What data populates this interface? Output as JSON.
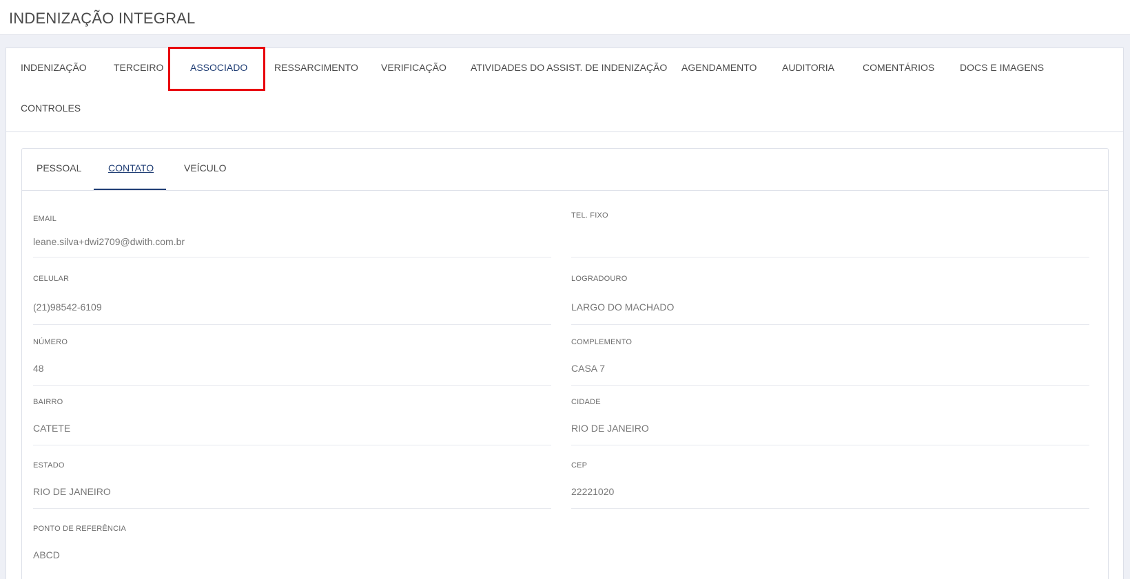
{
  "header": {
    "title": "INDENIZAÇÃO INTEGRAL"
  },
  "main_tabs": [
    {
      "label": "INDENIZAÇÃO"
    },
    {
      "label": "TERCEIRO"
    },
    {
      "label": "ASSOCIADO",
      "active": true
    },
    {
      "label": "RESSARCIMENTO"
    },
    {
      "label": "VERIFICAÇÃO"
    },
    {
      "label": "ATIVIDADES DO ASSIST. DE INDENIZAÇÃO"
    },
    {
      "label": "AGENDAMENTO"
    },
    {
      "label": "AUDITORIA"
    },
    {
      "label": "COMENTÁRIOS"
    },
    {
      "label": "DOCS E IMAGENS"
    },
    {
      "label": "CONTROLES"
    }
  ],
  "sub_tabs": [
    {
      "label": "PESSOAL"
    },
    {
      "label": "CONTATO",
      "active": true
    },
    {
      "label": "VEÍCULO"
    }
  ],
  "fields": {
    "email": {
      "label": "EMAIL",
      "value": "leane.silva+dwi2709@dwith.com.br"
    },
    "tel_fixo": {
      "label": "TEL. FIXO",
      "value": ""
    },
    "celular": {
      "label": "CELULAR",
      "value": "(21)98542-6109"
    },
    "logradouro": {
      "label": "LOGRADOURO",
      "value": "LARGO DO MACHADO"
    },
    "numero": {
      "label": "NÚMERO",
      "value": "48"
    },
    "complemento": {
      "label": "COMPLEMENTO",
      "value": "CASA 7"
    },
    "bairro": {
      "label": "BAIRRO",
      "value": "CATETE"
    },
    "cidade": {
      "label": "CIDADE",
      "value": "RIO DE JANEIRO"
    },
    "estado": {
      "label": "ESTADO",
      "value": "RIO DE JANEIRO"
    },
    "cep": {
      "label": "CEP",
      "value": "22221020"
    },
    "ponto_referencia": {
      "label": "PONTO DE REFERÊNCIA",
      "value": "ABCD"
    }
  },
  "colors": {
    "accent": "#1f3d74",
    "highlight": "#e8000c",
    "background": "#eef0f6"
  }
}
